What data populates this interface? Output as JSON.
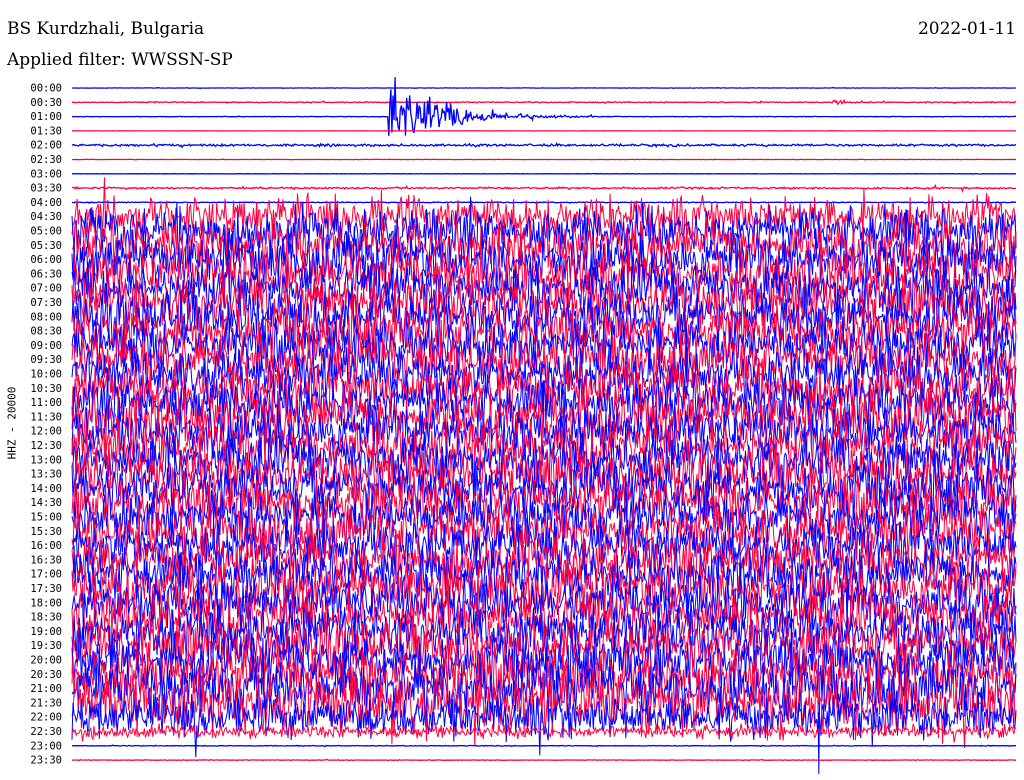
{
  "header": {
    "station": "BS Kurdzhali, Bulgaria",
    "date": "2022-01-11",
    "filter": "Applied filter: WWSSN-SP"
  },
  "channel_label": "HHZ - 20000",
  "colors": {
    "trace_a": "#0000ff",
    "trace_b": "#ff0040",
    "background": "#ffffff",
    "text": "#000000"
  },
  "chart_data": {
    "type": "line",
    "chart_kind": "helicorder (24-hour drum seismogram)",
    "row_interval_minutes": 30,
    "row_labels": [
      "00:00",
      "00:30",
      "01:00",
      "01:30",
      "02:00",
      "02:30",
      "03:00",
      "03:30",
      "04:00",
      "04:30",
      "05:00",
      "05:30",
      "06:00",
      "06:30",
      "07:00",
      "07:30",
      "08:00",
      "08:30",
      "09:00",
      "09:30",
      "10:00",
      "10:30",
      "11:00",
      "11:30",
      "12:00",
      "12:30",
      "13:00",
      "13:30",
      "14:00",
      "14:30",
      "15:00",
      "15:30",
      "16:00",
      "16:30",
      "17:00",
      "17:30",
      "18:00",
      "18:30",
      "19:00",
      "19:30",
      "20:00",
      "20:30",
      "21:00",
      "21:30",
      "22:00",
      "22:30",
      "23:00",
      "23:30"
    ],
    "color_alternation": [
      "#0000ff",
      "#ff0040"
    ],
    "relative_noise_amplitude": [
      0.02,
      0.06,
      0.03,
      0.01,
      0.12,
      0.02,
      0.02,
      0.1,
      0.05,
      2.2,
      2.5,
      2.5,
      2.6,
      2.6,
      2.6,
      2.6,
      2.6,
      2.6,
      2.6,
      2.6,
      2.6,
      2.6,
      2.7,
      2.7,
      2.6,
      2.6,
      2.6,
      2.6,
      2.6,
      2.6,
      2.6,
      2.6,
      2.6,
      2.6,
      2.6,
      2.6,
      2.6,
      2.6,
      2.6,
      2.6,
      2.6,
      2.7,
      3.0,
      3.3,
      2.2,
      0.7,
      0.04,
      0.03
    ],
    "events": [
      {
        "row": "01:00",
        "start_fraction": 0.335,
        "end_fraction": 0.6,
        "relative_peak": 4.6,
        "note": "large earthquake arrival"
      },
      {
        "row": "00:30",
        "start_fraction": 0.805,
        "end_fraction": 0.86,
        "relative_peak": 0.6,
        "note": "small event"
      },
      {
        "row": "22:00",
        "start_fraction": 0.48,
        "end_fraction": 0.5,
        "relative_peak": 4.0,
        "note": "large spike"
      }
    ],
    "grid": false,
    "legend": "none"
  }
}
